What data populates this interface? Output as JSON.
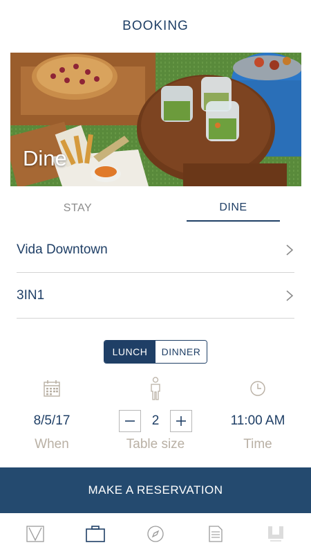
{
  "header": {
    "title": "BOOKING"
  },
  "hero": {
    "caption": "Dine"
  },
  "tabs": [
    {
      "label": "STAY",
      "active": false
    },
    {
      "label": "DINE",
      "active": true
    }
  ],
  "rows": [
    {
      "label": "Vida Downtown"
    },
    {
      "label": "3IN1"
    }
  ],
  "meal_toggle": {
    "lunch_label": "LUNCH",
    "dinner_label": "DINNER",
    "selected": "LUNCH"
  },
  "details": {
    "when": {
      "value": "8/5/17",
      "label": "When",
      "icon": "calendar-icon"
    },
    "table_size": {
      "value": "2",
      "label": "Table size",
      "icon": "person-icon",
      "decrement": "−",
      "increment": "+"
    },
    "time": {
      "value": "11:00 AM",
      "label": "Time",
      "icon": "clock-icon"
    }
  },
  "cta": {
    "label": "MAKE A RESERVATION"
  },
  "tabbar": {
    "items": [
      {
        "icon": "vida-logo-icon",
        "active": false
      },
      {
        "icon": "briefcase-icon",
        "active": true
      },
      {
        "icon": "compass-icon",
        "active": false
      },
      {
        "icon": "document-icon",
        "active": false
      },
      {
        "icon": "brand-logo-icon",
        "active": false
      }
    ]
  },
  "colors": {
    "primary": "#1f3f66",
    "cta": "#244a6f",
    "muted_label": "#b9b0a4",
    "inactive_tab": "#8c8c8c",
    "divider": "#d4d4d4"
  }
}
